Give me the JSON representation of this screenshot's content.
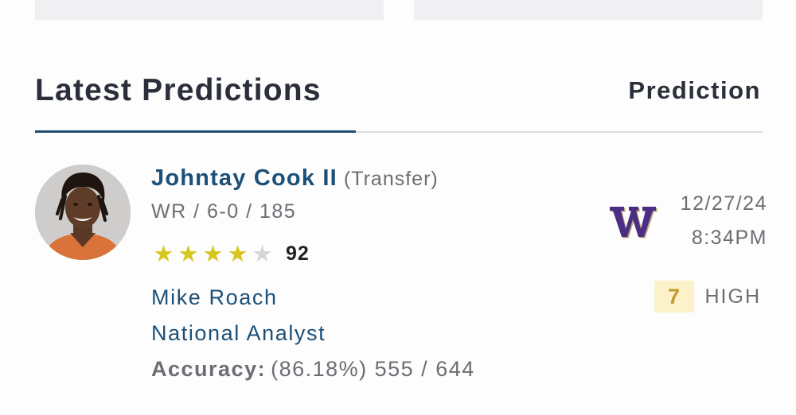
{
  "section": {
    "title": "Latest Predictions",
    "column_header": "Prediction"
  },
  "player": {
    "name": "Johntay Cook II",
    "tag": "(Transfer)",
    "meta": "WR / 6-0 / 185",
    "stars_filled": 4,
    "stars_total": 5,
    "rating": "92"
  },
  "analyst": {
    "name": "Mike Roach",
    "role": "National Analyst",
    "accuracy_label": "Accuracy:",
    "accuracy_value": "(86.18%) 555 / 644"
  },
  "prediction": {
    "team_logo_icon": "washington-w-logo",
    "date": "12/27/24",
    "time": "8:34PM",
    "confidence_score": "7",
    "confidence_level": "HIGH"
  },
  "colors": {
    "link_blue": "#1c5078",
    "accent_underline": "#1d4e6e",
    "star_gold": "#d7c620",
    "confidence_bg": "#fbf2c9",
    "washington_purple": "#4b2e83",
    "washington_gold": "#b7a57a"
  }
}
